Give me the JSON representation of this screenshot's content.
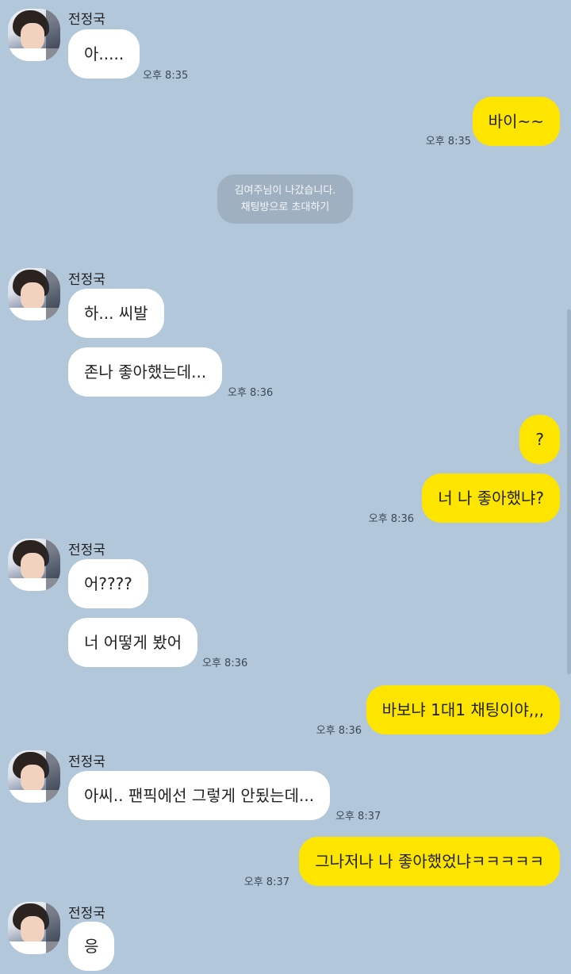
{
  "contact_name": "전정국",
  "colors": {
    "background": "#b2c7da",
    "my_bubble": "#fee500",
    "their_bubble": "#ffffff"
  },
  "notice": {
    "line1": "김여주님이 나갔습니다.",
    "line2": "채팅방으로 초대하기"
  },
  "messages": [
    {
      "from": "them",
      "text": "아.....",
      "time": "오후 8:35"
    },
    {
      "from": "me",
      "text": "바이~~",
      "time": "오후 8:35"
    },
    {
      "from": "them",
      "text": "하... 씨발",
      "time": ""
    },
    {
      "from": "them",
      "text": "존나 좋아했는데...",
      "time": "오후 8:36"
    },
    {
      "from": "me",
      "text": "?",
      "time": ""
    },
    {
      "from": "me",
      "text": "너 나 좋아했냐?",
      "time": "오후 8:36"
    },
    {
      "from": "them",
      "text": "어????",
      "time": ""
    },
    {
      "from": "them",
      "text": "너 어떻게 봤어",
      "time": "오후 8:36"
    },
    {
      "from": "me",
      "text": "바보냐 1대1 채팅이야,,,",
      "time": "오후 8:36"
    },
    {
      "from": "them",
      "text": "아씨.. 팬픽에선 그렇게 안됬는데...",
      "time": "오후 8:37"
    },
    {
      "from": "me",
      "text": "그나저나 나 좋아했었냐ㅋㅋㅋㅋㅋ",
      "time": "오후 8:37"
    },
    {
      "from": "them",
      "text": "응",
      "time": ""
    }
  ]
}
